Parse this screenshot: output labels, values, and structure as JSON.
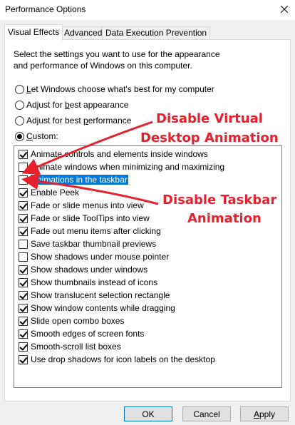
{
  "window": {
    "title": "Performance Options"
  },
  "tabs": [
    "Visual Effects",
    "Advanced",
    "Data Execution Prevention"
  ],
  "description": "Select the settings you want to use for the appearance and performance of Windows on this computer.",
  "radios": [
    {
      "label": "Let Windows choose what's best for my computer",
      "underline": "L",
      "checked": false
    },
    {
      "label": "Adjust for best appearance",
      "underline": "b",
      "checked": false
    },
    {
      "label": "Adjust for best performance",
      "underline": "p",
      "checked": false
    },
    {
      "label": "Custom:",
      "underline": "C",
      "checked": true
    }
  ],
  "settings": [
    {
      "label": "Animate controls and elements inside windows",
      "checked": true,
      "selected": false
    },
    {
      "label": "Animate windows when minimizing and maximizing",
      "checked": false,
      "selected": false
    },
    {
      "label": "Animations in the taskbar",
      "checked": false,
      "selected": true
    },
    {
      "label": "Enable Peek",
      "checked": true,
      "selected": false
    },
    {
      "label": "Fade or slide menus into view",
      "checked": true,
      "selected": false
    },
    {
      "label": "Fade or slide ToolTips into view",
      "checked": true,
      "selected": false
    },
    {
      "label": "Fade out menu items after clicking",
      "checked": true,
      "selected": false
    },
    {
      "label": "Save taskbar thumbnail previews",
      "checked": false,
      "selected": false
    },
    {
      "label": "Show shadows under mouse pointer",
      "checked": false,
      "selected": false
    },
    {
      "label": "Show shadows under windows",
      "checked": true,
      "selected": false
    },
    {
      "label": "Show thumbnails instead of icons",
      "checked": true,
      "selected": false
    },
    {
      "label": "Show translucent selection rectangle",
      "checked": true,
      "selected": false
    },
    {
      "label": "Show window contents while dragging",
      "checked": true,
      "selected": false
    },
    {
      "label": "Slide open combo boxes",
      "checked": true,
      "selected": false
    },
    {
      "label": "Smooth edges of screen fonts",
      "checked": true,
      "selected": false
    },
    {
      "label": "Smooth-scroll list boxes",
      "checked": true,
      "selected": false
    },
    {
      "label": "Use drop shadows for icon labels on the desktop",
      "checked": true,
      "selected": false
    }
  ],
  "buttons": {
    "ok": "OK",
    "cancel": "Cancel",
    "apply": "Apply",
    "apply_underline": "A"
  },
  "annotations": {
    "virtual_line1": "Disable Virtual",
    "virtual_line2": "Desktop Animation",
    "taskbar_line1": "Disable Taskbar",
    "taskbar_line2": "Animation",
    "color": "#e6202c"
  },
  "icons": {
    "close": "close-icon"
  }
}
